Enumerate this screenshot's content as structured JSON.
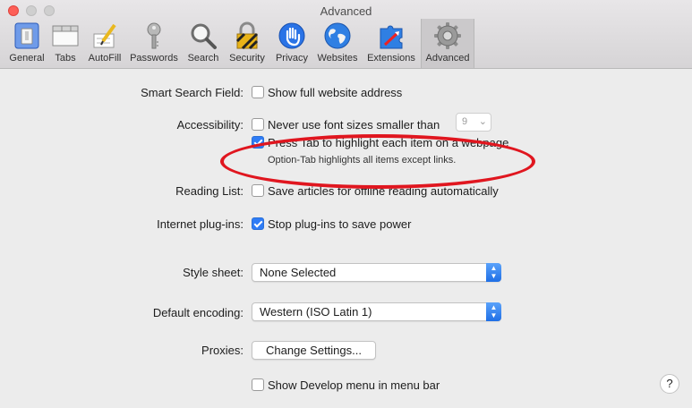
{
  "window": {
    "title": "Advanced"
  },
  "toolbar": {
    "tabs": [
      {
        "label": "General",
        "icon": "general-icon"
      },
      {
        "label": "Tabs",
        "icon": "tabs-icon"
      },
      {
        "label": "AutoFill",
        "icon": "autofill-icon"
      },
      {
        "label": "Passwords",
        "icon": "passwords-key-icon"
      },
      {
        "label": "Search",
        "icon": "search-icon"
      },
      {
        "label": "Security",
        "icon": "security-lock-icon"
      },
      {
        "label": "Privacy",
        "icon": "privacy-hand-icon"
      },
      {
        "label": "Websites",
        "icon": "websites-globe-icon"
      },
      {
        "label": "Extensions",
        "icon": "extensions-icon"
      },
      {
        "label": "Advanced",
        "icon": "gear-icon"
      }
    ],
    "active": "Advanced"
  },
  "settings": {
    "smart_search_label": "Smart Search Field:",
    "smart_search_option": "Show full website address",
    "smart_search_checked": false,
    "accessibility_label": "Accessibility:",
    "font_size_option": "Never use font sizes smaller than",
    "font_size_checked": false,
    "font_size_value": "9",
    "press_tab_option": "Press Tab to highlight each item on a webpage",
    "press_tab_checked": true,
    "press_tab_note": "Option-Tab highlights all items except links.",
    "reading_list_label": "Reading List:",
    "reading_list_option": "Save articles for offline reading automatically",
    "reading_list_checked": false,
    "plugins_label": "Internet plug-ins:",
    "plugins_option": "Stop plug-ins to save power",
    "plugins_checked": true,
    "style_sheet_label": "Style sheet:",
    "style_sheet_value": "None Selected",
    "encoding_label": "Default encoding:",
    "encoding_value": "Western (ISO Latin 1)",
    "proxies_label": "Proxies:",
    "proxies_button": "Change Settings...",
    "develop_option": "Show Develop menu in menu bar",
    "develop_checked": false,
    "help_label": "?"
  },
  "colors": {
    "accent": "#2e7cf6",
    "annotation": "#e0161f"
  }
}
